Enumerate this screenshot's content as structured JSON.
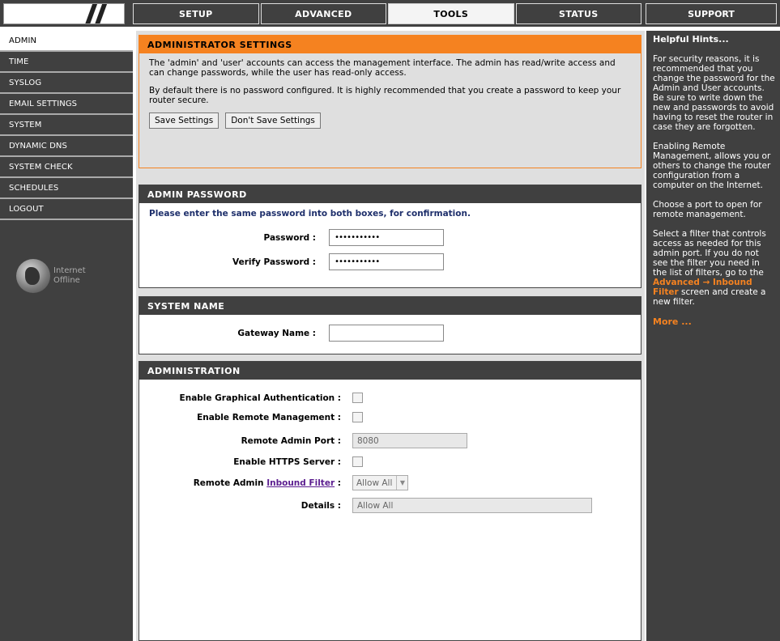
{
  "tabs": [
    "SETUP",
    "ADVANCED",
    "TOOLS",
    "STATUS"
  ],
  "active_tab": "TOOLS",
  "support_tab": "SUPPORT",
  "nav": [
    "ADMIN",
    "TIME",
    "SYSLOG",
    "EMAIL SETTINGS",
    "SYSTEM",
    "DYNAMIC DNS",
    "SYSTEM CHECK",
    "SCHEDULES",
    "LOGOUT"
  ],
  "nav_active": "ADMIN",
  "internet_status": {
    "line1": "Internet",
    "line2": "Offline"
  },
  "admin_settings": {
    "title": "ADMINISTRATOR SETTINGS",
    "p1": "The 'admin' and 'user' accounts can access the management interface. The admin has read/write access and can change passwords, while the user has read-only access.",
    "p2": "By default there is no password configured. It is highly recommended that you create a password to keep your router secure.",
    "save_label": "Save Settings",
    "dont_save_label": "Don't Save Settings"
  },
  "admin_password": {
    "title": "ADMIN PASSWORD",
    "instruction": "Please enter the same password into both boxes, for confirmation.",
    "password_label": "Password :",
    "password_value": "•••••••••••",
    "verify_label": "Verify Password :",
    "verify_value": "•••••••••••"
  },
  "system_name": {
    "title": "SYSTEM NAME",
    "gateway_label": "Gateway Name :",
    "gateway_value": ""
  },
  "administration": {
    "title": "ADMINISTRATION",
    "graphical_auth_label": "Enable Graphical Authentication :",
    "remote_mgmt_label": "Enable Remote Management :",
    "remote_port_label": "Remote Admin Port :",
    "remote_port_value": "8080",
    "https_label": "Enable HTTPS Server :",
    "filter_label_prefix": "Remote Admin",
    "filter_link": "Inbound Filter",
    "filter_colon": " :",
    "filter_value": "Allow All",
    "details_label": "Details :",
    "details_value": "Allow All"
  },
  "hints": {
    "title": "Helpful Hints...",
    "h1": "For security reasons, it is recommended that you change the password for the Admin and User accounts. Be sure to write down the new and passwords to avoid having to reset the router in case they are forgotten.",
    "h2": "Enabling Remote Management, allows you or others to change the router configuration from a computer on the Internet.",
    "h3": "Choose a port to open for remote management.",
    "h4_pre": "Select a filter that controls access as needed for this admin port. If you do not see the filter you need in the list of filters, go to the",
    "h4_link": "Advanced → Inbound Filter",
    "h4_post": "screen and create a new filter.",
    "more": "More ..."
  },
  "colors": {
    "accent_orange": "#f58220",
    "dark": "#404040",
    "panel_gray": "#dfdfdf"
  }
}
